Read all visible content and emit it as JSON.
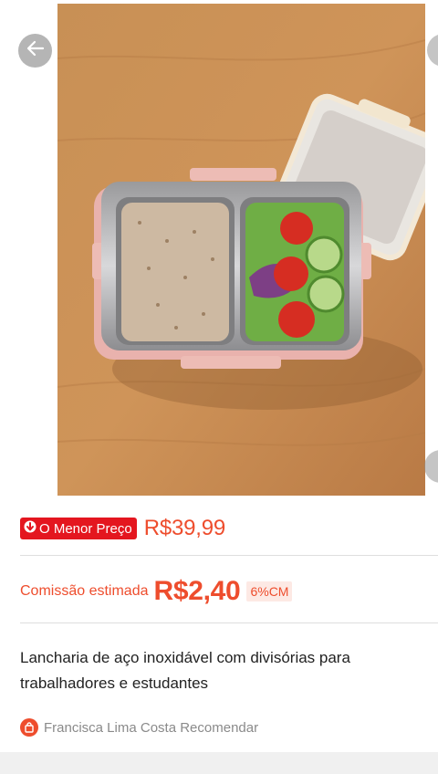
{
  "product": {
    "badge_label": "O Menor Preço",
    "price": "R$39,99",
    "commission_label": "Comissão estimada",
    "commission_value": "R$2,40",
    "commission_rate": "6%CM",
    "title": "Lancharia de aço inoxidável com divisórias para trabalhadores e estudantes",
    "recommender": "Francisca Lima Costa Recomendar"
  },
  "colors": {
    "accent": "#ee4d2d",
    "badge": "#e4161f",
    "rate_bg": "#fde9e4",
    "text": "#222222",
    "muted": "#8a8a8a"
  },
  "icons": {
    "back": "arrow-left-icon",
    "badge": "arrow-down-icon",
    "recommender": "shop-bag-icon"
  }
}
